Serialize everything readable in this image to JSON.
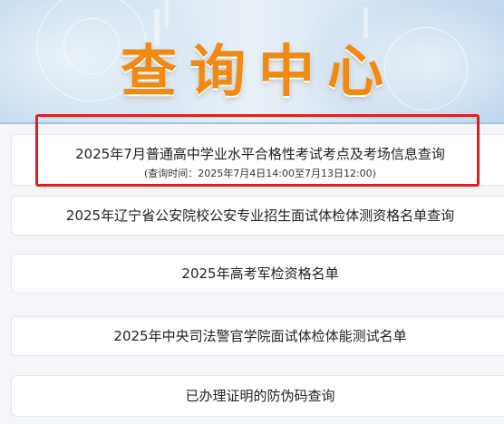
{
  "banner": {
    "title": "查询中心"
  },
  "items": [
    {
      "label": "2025年7月普通高中学业水平合格性考试考点及考场信息查询",
      "sub": "(查询时间：2025年7月4日14:00至7月13日12:00)"
    },
    {
      "label": "2025年辽宁省公安院校公安专业招生面试体检体测资格名单查询"
    },
    {
      "label": "2025年高考军检资格名单"
    },
    {
      "label": "2025年中央司法警官学院面试体检体能测试名单"
    },
    {
      "label": "已办理证明的防伪码查询"
    }
  ],
  "colors": {
    "title": "#f08a12",
    "highlight": "#e0201f",
    "divider": "#9cc7ec"
  }
}
